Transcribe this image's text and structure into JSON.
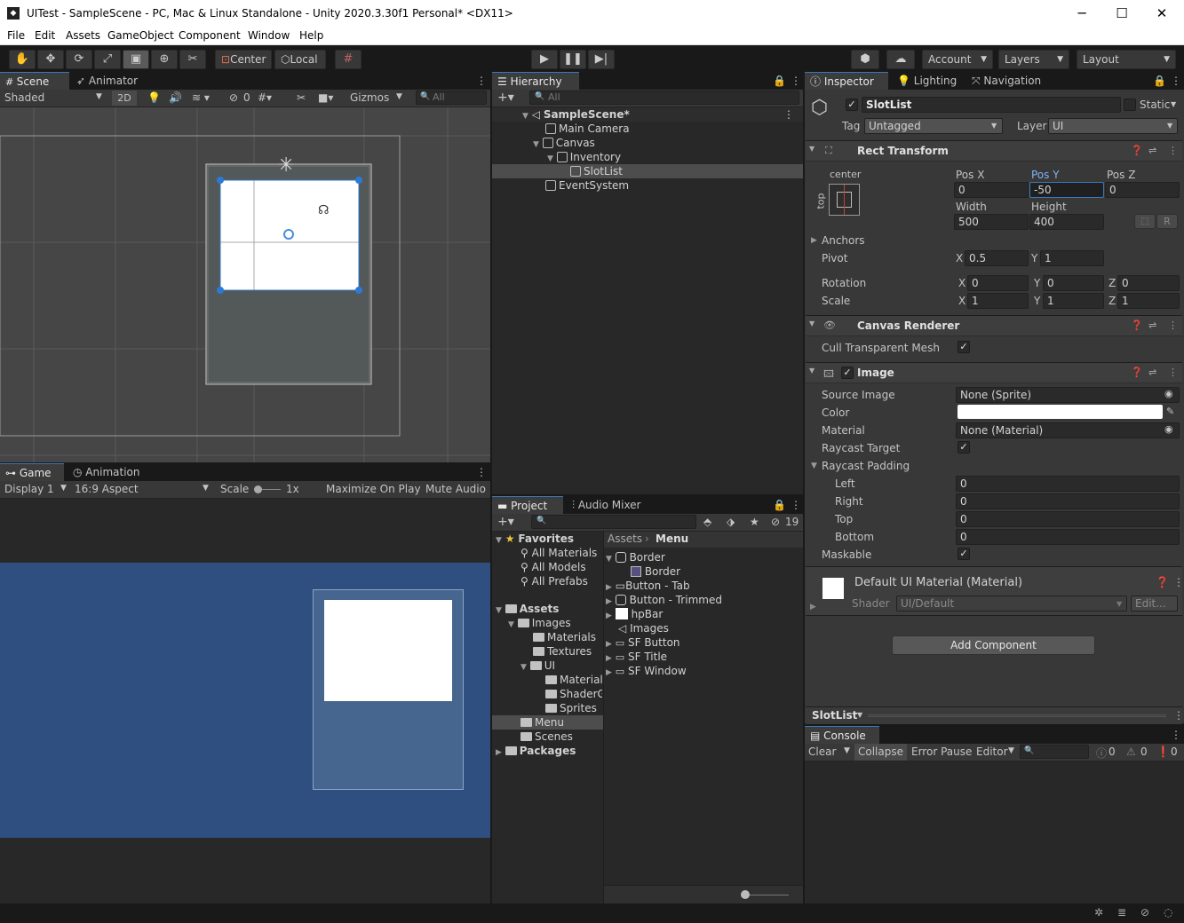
{
  "window": {
    "title": "UITest - SampleScene - PC, Mac & Linux Standalone - Unity 2020.3.30f1 Personal* <DX11>",
    "minimize": "─",
    "maximize": "☐",
    "close": "✕"
  },
  "menu": [
    "File",
    "Edit",
    "Assets",
    "GameObject",
    "Component",
    "Window",
    "Help"
  ],
  "toolbar": {
    "center_label": "Center",
    "local_label": "Local",
    "account_label": "Account",
    "layers_label": "Layers",
    "layout_label": "Layout"
  },
  "scene": {
    "tab_scene": "Scene",
    "tab_animator": "Animator",
    "shading": "Shaded",
    "mode_2d": "2D",
    "hidden_count": "0",
    "gizmos": "Gizmos",
    "search_placeholder": "All"
  },
  "game": {
    "tab_game": "Game",
    "tab_animation": "Animation",
    "display": "Display 1",
    "aspect": "16:9 Aspect",
    "scale_label": "Scale",
    "scale_value": "1x",
    "maximize": "Maximize On Play",
    "mute": "Mute Audio"
  },
  "hierarchy": {
    "tab": "Hierarchy",
    "search_placeholder": "All",
    "items": [
      "SampleScene*",
      "Main Camera",
      "Canvas",
      "Inventory",
      "SlotList",
      "EventSystem"
    ]
  },
  "project": {
    "tab_project": "Project",
    "tab_audio": "Audio Mixer",
    "hidden_count": "19",
    "favorites": "Favorites",
    "fav_items": [
      "All Materials",
      "All Models",
      "All Prefabs"
    ],
    "assets": "Assets",
    "tree": [
      "Images",
      "Materials",
      "Textures",
      "UI",
      "Materials",
      "ShaderG",
      "Sprites",
      "Menu",
      "Scenes"
    ],
    "packages": "Packages",
    "breadcrumb": [
      "Assets",
      "Menu"
    ],
    "files": [
      "Border",
      "Border",
      "Button - Tab",
      "Button - Trimmed",
      "hpBar",
      "Images",
      "SF Button",
      "SF Title",
      "SF Window"
    ]
  },
  "inspector": {
    "tab_inspector": "Inspector",
    "tab_lighting": "Lighting",
    "tab_navigation": "Navigation",
    "object_name": "SlotList",
    "static_label": "Static",
    "tag_label": "Tag",
    "tag_value": "Untagged",
    "layer_label": "Layer",
    "layer_value": "UI",
    "rect": {
      "title": "Rect Transform",
      "anchor_h": "center",
      "anchor_v": "top",
      "pos_x_label": "Pos X",
      "pos_y_label": "Pos Y",
      "pos_z_label": "Pos Z",
      "pos_x": "0",
      "pos_y": "-50",
      "pos_z": "0",
      "width_label": "Width",
      "height_label": "Height",
      "width": "500",
      "height": "400",
      "r_btn": "R",
      "anchors_label": "Anchors",
      "pivot_label": "Pivot",
      "pivot_x": "0.5",
      "pivot_y": "1",
      "rotation_label": "Rotation",
      "rot_x": "0",
      "rot_y": "0",
      "rot_z": "0",
      "scale_label": "Scale",
      "scale_x": "1",
      "scale_y": "1",
      "scale_z": "1",
      "x": "X",
      "y": "Y",
      "z": "Z"
    },
    "canvas_renderer": {
      "title": "Canvas Renderer",
      "cull_label": "Cull Transparent Mesh"
    },
    "image": {
      "title": "Image",
      "source_label": "Source Image",
      "source_value": "None (Sprite)",
      "color_label": "Color",
      "color_value": "#ffffff",
      "material_label": "Material",
      "material_value": "None (Material)",
      "raycast_label": "Raycast Target",
      "padding_label": "Raycast Padding",
      "left_label": "Left",
      "right_label": "Right",
      "top_label": "Top",
      "bottom_label": "Bottom",
      "left": "0",
      "right": "0",
      "top": "0",
      "bottom": "0",
      "maskable_label": "Maskable"
    },
    "material": {
      "title": "Default UI Material (Material)",
      "shader_label": "Shader",
      "shader_value": "UI/Default",
      "edit": "Edit..."
    },
    "add_component": "Add Component",
    "preview_label": "SlotList"
  },
  "console": {
    "tab": "Console",
    "clear": "Clear",
    "collapse": "Collapse",
    "error_pause": "Error Pause",
    "editor": "Editor",
    "log_count": "0",
    "warn_count": "0",
    "err_count": "0"
  },
  "colors": {
    "accent": "#3a79bb",
    "game_bg": "#2f4f80",
    "scene_bg": "#464646"
  }
}
